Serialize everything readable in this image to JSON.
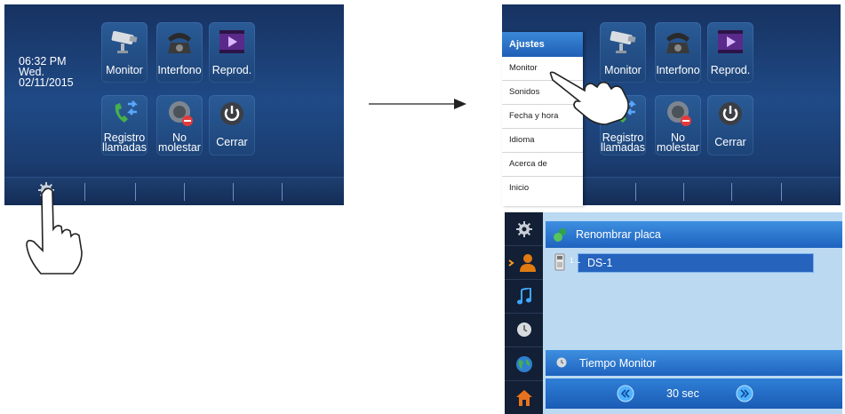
{
  "home": {
    "clock": {
      "time": "06:32 PM",
      "day": "Wed.",
      "date": "02/11/2015"
    },
    "apps": [
      {
        "label": "Monitor"
      },
      {
        "label": "Interfono"
      },
      {
        "label": "Reprod."
      },
      {
        "label": "Registro llamadas",
        "line1": "Registro",
        "line2": "llamadas"
      },
      {
        "label": "No molestar",
        "line1": "No",
        "line2": "molestar"
      },
      {
        "label": "Cerrar"
      }
    ]
  },
  "settings_menu": {
    "title": "Ajustes",
    "items": [
      "Monitor",
      "Sonidos",
      "Fecha y hora",
      "Idioma",
      "Acerca de",
      "Inicio"
    ]
  },
  "monitor_settings": {
    "rename_title": "Renombrar placa",
    "device": {
      "index": "1",
      "name": "DS-1"
    },
    "monitor_time_title": "Tiempo Monitor",
    "monitor_time_value": "30 sec"
  },
  "colors": {
    "accent": "#2b74cf",
    "screen_bg": "#1f4a86",
    "menu_header": "#2b74cf"
  }
}
